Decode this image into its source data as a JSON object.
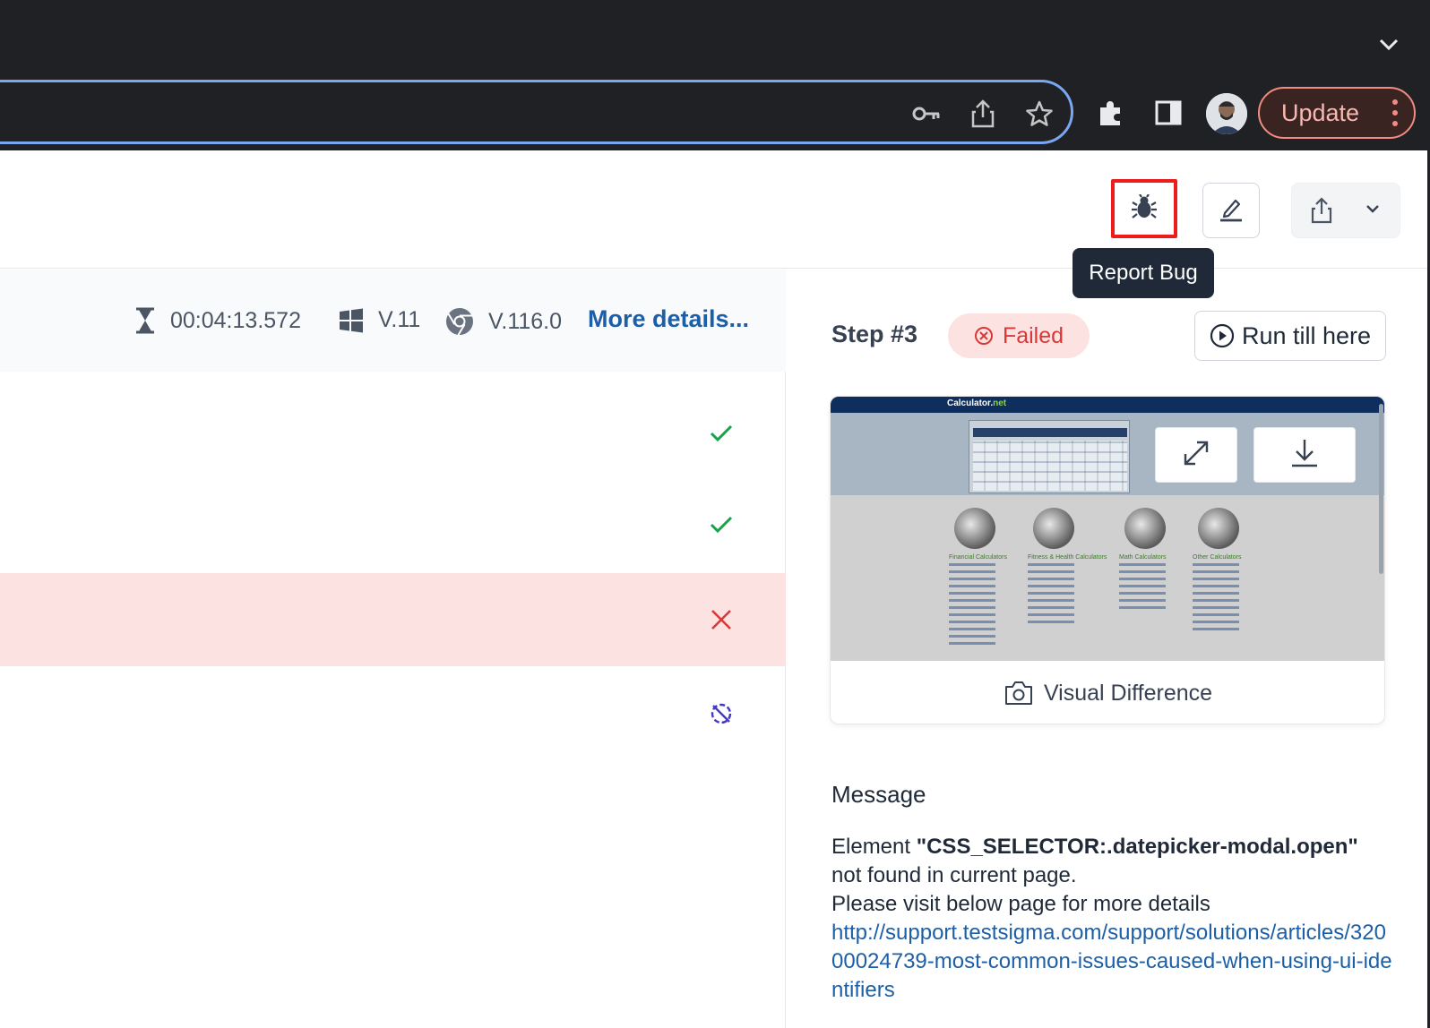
{
  "browser": {
    "update_label": "Update",
    "icons": [
      "key-icon",
      "share-icon",
      "star-icon",
      "extensions-icon",
      "side-panel-icon",
      "profile-avatar",
      "menu-dots-icon",
      "chevron-down-icon"
    ]
  },
  "header": {
    "tooltip": "Report Bug"
  },
  "run_meta": {
    "duration": "00:04:13.572",
    "os_version": "V.11",
    "browser_version": "V.116.0",
    "more_details": "More details..."
  },
  "steps": [
    {
      "status": "passed"
    },
    {
      "status": "passed"
    },
    {
      "status": "failed"
    },
    {
      "status": "skipped"
    }
  ],
  "step_detail": {
    "step_label": "Step #3",
    "status_label": "Failed",
    "run_till_here": "Run till here",
    "screenshot": {
      "logo_text": "Calculator.",
      "logo_suffix": "net",
      "footer_label": "Visual Difference",
      "categories": [
        {
          "title": "Financial Calculators"
        },
        {
          "title": "Fitness & Health Calculators"
        },
        {
          "title": "Math Calculators"
        },
        {
          "title": "Other Calculators"
        }
      ]
    },
    "message_title": "Message",
    "message_prefix": "Element ",
    "message_selector": "\"CSS_SELECTOR:.datepicker-modal.open\"",
    "message_line2": "not found in current page.",
    "message_line3": "Please visit below page for more details",
    "message_link": "http://support.testsigma.com/support/solutions/articles/32000024739-most-common-issues-caused-when-using-ui-identifiers"
  },
  "colors": {
    "link": "#1d5fa6",
    "failed": "#d93838",
    "passed": "#16a34a",
    "skipped": "#4338ca",
    "failed_row_bg": "#fde2e2"
  }
}
